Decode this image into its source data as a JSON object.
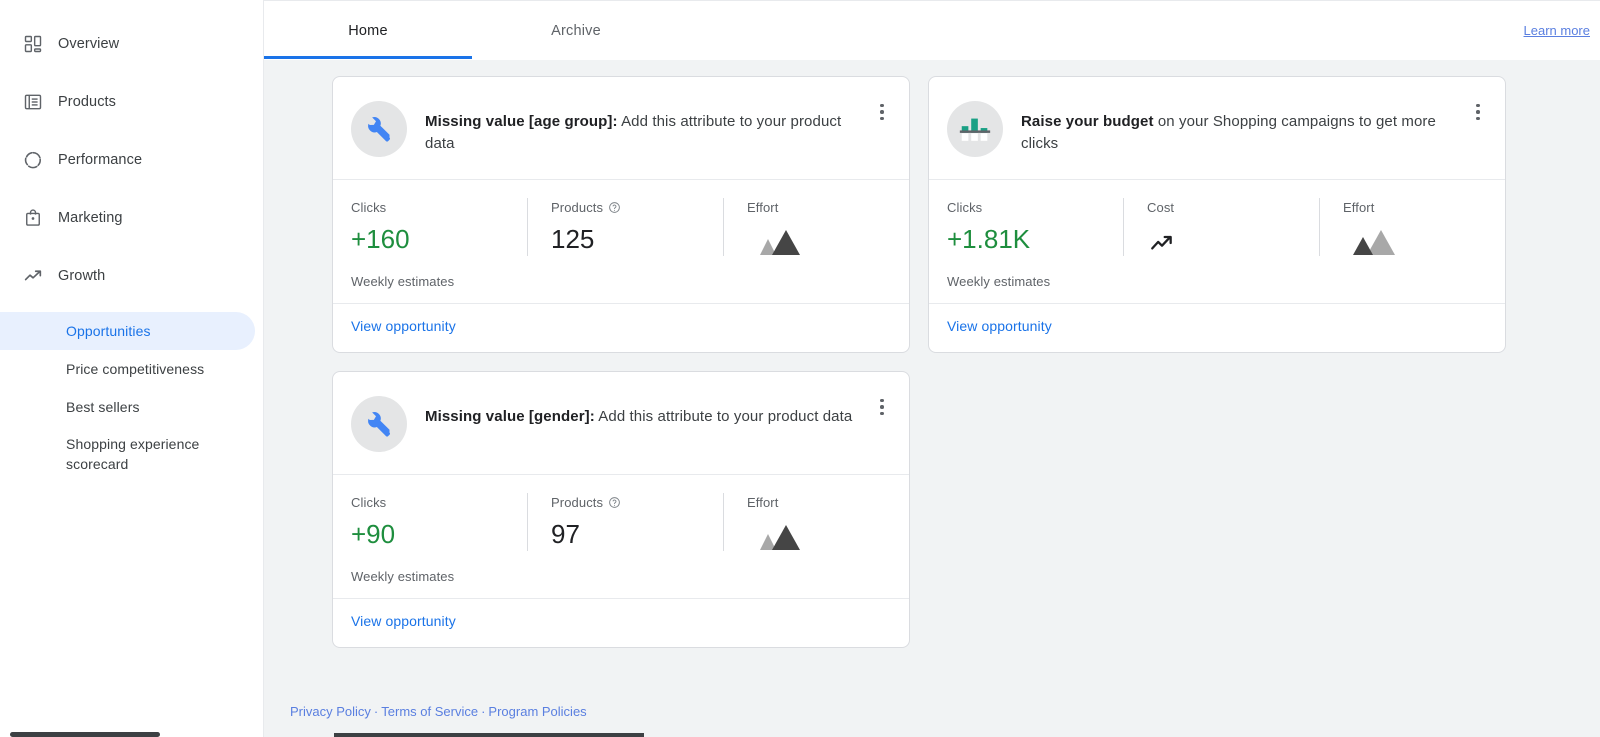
{
  "sidebar": {
    "items": [
      {
        "label": "Overview",
        "icon": "dashboard-icon"
      },
      {
        "label": "Products",
        "icon": "list-icon"
      },
      {
        "label": "Performance",
        "icon": "performance-circle-icon"
      },
      {
        "label": "Marketing",
        "icon": "shopping-bag-icon"
      },
      {
        "label": "Growth",
        "icon": "trending-up-icon"
      }
    ],
    "subitems": [
      {
        "label": "Opportunities",
        "active": true
      },
      {
        "label": "Price competitiveness",
        "active": false
      },
      {
        "label": "Best sellers",
        "active": false
      },
      {
        "label": "Shopping experience scorecard",
        "active": false
      }
    ]
  },
  "tabs": [
    {
      "label": "Home",
      "active": true
    },
    {
      "label": "Archive",
      "active": false
    }
  ],
  "header": {
    "learn_more": "Learn more"
  },
  "cards": [
    {
      "icon": "wrench-icon",
      "title_bold": "Missing value [age group]:",
      "title_rest": " Add this attribute to your product data",
      "metrics": [
        {
          "label": "Clicks",
          "value": "+160",
          "style": "green",
          "type": "text"
        },
        {
          "label": "Products",
          "value": "125",
          "style": "plain",
          "type": "text",
          "help": true
        },
        {
          "label": "Effort",
          "value": "",
          "style": "plain",
          "type": "effort-high",
          "help": false
        }
      ],
      "note": "Weekly estimates",
      "action": "View opportunity",
      "menu": "more-options-icon"
    },
    {
      "icon": "bar-chart-icon",
      "title_bold": "Raise your budget",
      "title_rest": " on your Shopping campaigns to get more clicks",
      "metrics": [
        {
          "label": "Clicks",
          "value": "+1.81K",
          "style": "green",
          "type": "text"
        },
        {
          "label": "Cost",
          "value": "",
          "style": "plain",
          "type": "trend-up"
        },
        {
          "label": "Effort",
          "value": "",
          "style": "plain",
          "type": "effort-low"
        }
      ],
      "note": "Weekly estimates",
      "action": "View opportunity",
      "menu": "more-options-icon"
    },
    {
      "icon": "wrench-icon",
      "title_bold": "Missing value [gender]:",
      "title_rest": " Add this attribute to your product data",
      "metrics": [
        {
          "label": "Clicks",
          "value": "+90",
          "style": "green",
          "type": "text"
        },
        {
          "label": "Products",
          "value": "97",
          "style": "plain",
          "type": "text",
          "help": true
        },
        {
          "label": "Effort",
          "value": "",
          "style": "plain",
          "type": "effort-high",
          "help": false
        }
      ],
      "note": "Weekly estimates",
      "action": "View opportunity",
      "menu": "more-options-icon"
    }
  ],
  "footer": {
    "links": [
      "Privacy Policy",
      "Terms of Service",
      "Program Policies"
    ],
    "separator": "·"
  },
  "colors": {
    "accent_blue": "#1a73e8",
    "active_bg": "#e8f0fe",
    "green": "#1e8e3e",
    "teal": "#1aa085",
    "page_bg": "#f1f3f4",
    "effort_dark": "#454545",
    "effort_light": "#a8a8a8"
  }
}
